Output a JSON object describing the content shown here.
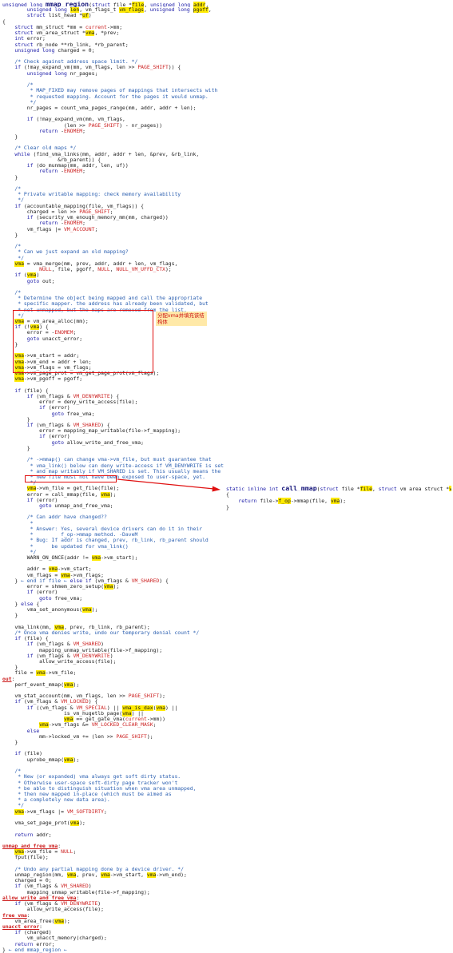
{
  "code_lines": [
    "<span class=\"k\">unsigned long</span> <span class=\"fn big\">mmap_region</span>(<span class=\"k\">struct</span> file *<span class=\"hl\">file</span>, <span class=\"k\">unsigned long</span> <span class=\"hl\">addr</span>,",
    "        <span class=\"k\">unsigned long</span> <span class=\"hl\">len</span>, vm_flags_t <span class=\"hl\">vm_flags</span>, <span class=\"k\">unsigned long</span> <span class=\"hl\">pgoff</span>,",
    "        <span class=\"k\">struct</span> list_head *<span class=\"hl\">uf</span>)",
    "{",
    "    <span class=\"k\">struct</span> mm_struct *mm = <span class=\"m\">current</span>-&gt;mm;",
    "    <span class=\"k\">struct</span> vm_area_struct *<span class=\"hl\">vma</span>, *prev;",
    "    <span class=\"k\">int</span> error;",
    "    <span class=\"k\">struct</span> rb_node **rb_link, *rb_parent;",
    "    <span class=\"k\">unsigned long</span> charged = 0;",
    "",
    "    <span class=\"c\">/* Check against address space limit. */</span>",
    "    <span class=\"k\">if</span> (!may_expand_vm(mm, vm_flags, len &gt;&gt; <span class=\"m\">PAGE_SHIFT</span>)) {",
    "        <span class=\"k\">unsigned long</span> nr_pages;",
    "",
    "<span class=\"c\">        /*</span>",
    "<span class=\"c\">         * MAP_FIXED may remove pages of mappings that intersects with</span>",
    "<span class=\"c\">         * requested mapping. Account for the pages it would unmap.</span>",
    "<span class=\"c\">         */</span>",
    "        nr_pages = count_vma_pages_range(mm, addr, addr + len);",
    "",
    "        <span class=\"k\">if</span> (!may_expand_vm(mm, vm_flags,",
    "                    (len &gt;&gt; <span class=\"m\">PAGE_SHIFT</span>) - nr_pages))",
    "            <span class=\"k\">return</span> -<span class=\"m\">ENOMEM</span>;",
    "    }",
    "",
    "    <span class=\"c\">/* Clear old maps */</span>",
    "    <span class=\"k\">while</span> (find_vma_links(mm, addr, addr + len, &amp;prev, &amp;rb_link,",
    "                  &amp;rb_parent)) {",
    "        <span class=\"k\">if</span> (do_munmap(mm, addr, len, uf))",
    "            <span class=\"k\">return</span> -<span class=\"m\">ENOMEM</span>;",
    "    }",
    "",
    "<span class=\"c\">    /*</span>",
    "<span class=\"c\">     * Private writable mapping: check memory availability</span>",
    "<span class=\"c\">     */</span>",
    "    <span class=\"k\">if</span> (accountable_mapping(file, vm_flags)) {",
    "        charged = len &gt;&gt; <span class=\"m\">PAGE_SHIFT</span>;",
    "        <span class=\"k\">if</span> (security_vm_enough_memory_mm(mm, charged))",
    "            <span class=\"k\">return</span> -<span class=\"m\">ENOMEM</span>;",
    "        vm_flags |= <span class=\"m\">VM_ACCOUNT</span>;",
    "    }",
    "",
    "<span class=\"c\">    /*</span>",
    "<span class=\"c\">     * Can we just expand an old mapping?</span>",
    "<span class=\"c\">     */</span>",
    "    <span class=\"hl\">vma</span> = vma_merge(mm, prev, addr, addr + len, vm_flags,",
    "            <span class=\"m\">NULL</span>, file, pgoff, <span class=\"m\">NULL</span>, <span class=\"m\">NULL_VM_UFFD_CTX</span>);",
    "    <span class=\"k\">if</span> (<span class=\"hl\">vma</span>)",
    "        <span class=\"k\">goto</span> out;",
    "",
    "<span class=\"c\">    /*</span>",
    "<span class=\"c\">     * Determine the object being mapped and call the appropriate</span>",
    "<span class=\"c\">     * specific mapper. the address has already been validated, but</span>",
    "<span class=\"c\">     * not unmapped, but the maps are removed from the list.</span>",
    "<span class=\"c\">     */</span>",
    "    <span class=\"hl\">vma</span> = vm_area_alloc(mm);",
    "    <span class=\"k\">if</span> (!<span class=\"hl\">vma</span>) {",
    "        error = -<span class=\"m\">ENOMEM</span>;",
    "        <span class=\"k\">goto</span> unacct_error;",
    "    }",
    "",
    "    <span class=\"hl\">vma</span>-&gt;vm_start = addr;",
    "    <span class=\"hl\">vma</span>-&gt;vm_end = addr + len;",
    "    <span class=\"hl\">vma</span>-&gt;vm_flags = vm_flags;",
    "    <span class=\"hl\">vma</span>-&gt;vm_page_prot = vm_get_page_prot(vm_flags);",
    "    <span class=\"hl\">vma</span>-&gt;vm_pgoff = pgoff;",
    "",
    "    <span class=\"k\">if</span> (file) {",
    "        <span class=\"k\">if</span> (vm_flags &amp; <span class=\"m\">VM_DENYWRITE</span>) {",
    "            error = deny_write_access(file);",
    "            <span class=\"k\">if</span> (error)",
    "                <span class=\"k\">goto</span> free_vma;",
    "        }",
    "        <span class=\"k\">if</span> (vm_flags &amp; <span class=\"m\">VM_SHARED</span>) {",
    "            error = mapping_map_writable(file-&gt;f_mapping);",
    "            <span class=\"k\">if</span> (error)",
    "                <span class=\"k\">goto</span> allow_write_and_free_vma;",
    "        }",
    "",
    "<span class=\"c\">        /* -&gt;mmap() can change vma-&gt;vm_file, but must guarantee that</span>",
    "<span class=\"c\">         * vma_link() below can deny write-access if VM_DENYWRITE is set</span>",
    "<span class=\"c\">         * and map writably if VM_SHARED is set. This usually means the</span>",
    "<span class=\"c\">         * new file must not have been exposed to user-space, yet.</span>",
    "<span class=\"c\">         */</span>",
    "        <span class=\"hl\">vma</span>-&gt;vm_file = get_file(file);",
    "        error = call_mmap(file, <span class=\"hl\">vma</span>);",
    "        <span class=\"k\">if</span> (error)",
    "            <span class=\"k\">goto</span> unmap_and_free_vma;",
    "",
    "        <span class=\"c\">/* Can addr have changed??</span>",
    "<span class=\"c\">         *</span>",
    "<span class=\"c\">         * Answer: Yes, several device drivers can do it in their</span>",
    "<span class=\"c\">         *         f_op-&gt;mmap method. -DaveM</span>",
    "<span class=\"c\">         * Bug: If addr is changed, prev, rb_link, rb_parent should</span>",
    "<span class=\"c\">         *      be updated for vma_link()</span>",
    "<span class=\"c\">         */</span>",
    "        WARN_ON_ONCE(addr != <span class=\"hl\">vma</span>-&gt;vm_start);",
    "",
    "        addr = <span class=\"hl\">vma</span>-&gt;vm_start;",
    "        vm_flags = <span class=\"hl\">vma</span>-&gt;vm_flags;",
    "    } <span class=\"c\">&#8592; end if file &#8592;</span> <span class=\"k\">else if</span> (vm_flags &amp; <span class=\"m\">VM_SHARED</span>) {",
    "        error = shmem_zero_setup(<span class=\"hl\">vma</span>);",
    "        <span class=\"k\">if</span> (error)",
    "            <span class=\"k\">goto</span> free_vma;",
    "    } <span class=\"k\">else</span> {",
    "        vma_set_anonymous(<span class=\"hl\">vma</span>);",
    "    }",
    "",
    "    vma_link(mm, <span class=\"hl\">vma</span>, prev, rb_link, rb_parent);",
    "    <span class=\"c\">/* Once vma denies write, undo our temporary denial count */</span>",
    "    <span class=\"k\">if</span> (file) {",
    "        <span class=\"k\">if</span> (vm_flags &amp; <span class=\"m\">VM_SHARED</span>)",
    "            mapping_unmap_writable(file-&gt;f_mapping);",
    "        <span class=\"k\">if</span> (vm_flags &amp; <span class=\"m\">VM_DENYWRITE</span>)",
    "            allow_write_access(file);",
    "    }",
    "    file = <span class=\"hl\">vma</span>-&gt;vm_file;",
    "<span class=\"lbl\">out</span>:",
    "    perf_event_mmap(<span class=\"hl\">vma</span>);",
    "",
    "    vm_stat_account(mm, vm_flags, len &gt;&gt; <span class=\"m\">PAGE_SHIFT</span>);",
    "    <span class=\"k\">if</span> (vm_flags &amp; <span class=\"m\">VM_LOCKED</span>) {",
    "        <span class=\"k\">if</span> ((vm_flags &amp; <span class=\"m\">VM_SPECIAL</span>) || <span class=\"hl\">vma_is_dax</span>(<span class=\"hl\">vma</span>) ||",
    "                    is_vm_hugetlb_page(<span class=\"hl\">vma</span>) ||",
    "                    <span class=\"hl\">vma</span> == get_gate_vma(<span class=\"m\">current</span>-&gt;mm))",
    "            <span class=\"hl\">vma</span>-&gt;vm_flags &amp;= <span class=\"m\">VM_LOCKED_CLEAR_MASK</span>;",
    "        <span class=\"k\">else</span>",
    "            mm-&gt;locked_vm += (len &gt;&gt; <span class=\"m\">PAGE_SHIFT</span>);",
    "    }",
    "",
    "    <span class=\"k\">if</span> (file)",
    "        uprobe_mmap(<span class=\"hl\">vma</span>);",
    "",
    "<span class=\"c\">    /*</span>",
    "<span class=\"c\">     * New (or expanded) vma always get soft dirty status.</span>",
    "<span class=\"c\">     * Otherwise user-space soft-dirty page tracker won't</span>",
    "<span class=\"c\">     * be able to distinguish situation when vma area unmapped,</span>",
    "<span class=\"c\">     * then new mapped in-place (which must be aimed as</span>",
    "<span class=\"c\">     * a completely new data area).</span>",
    "<span class=\"c\">     */</span>",
    "    <span class=\"hl\">vma</span>-&gt;vm_flags |= <span class=\"m\">VM_SOFTDIRTY</span>;",
    "",
    "    vma_set_page_prot(<span class=\"hl\">vma</span>);",
    "",
    "    <span class=\"k\">return</span> addr;",
    "",
    "<span class=\"lbl\">unmap_and_free_vma</span>:",
    "    <span class=\"hl\">vma</span>-&gt;vm_file = <span class=\"m\">NULL</span>;",
    "    fput(file);",
    "",
    "    <span class=\"c\">/* Undo any partial mapping done by a device driver. */</span>",
    "    unmap_region(mm, <span class=\"hl\">vma</span>, prev, <span class=\"hl\">vma</span>-&gt;vm_start, <span class=\"hl\">vma</span>-&gt;vm_end);",
    "    charged = 0;",
    "    <span class=\"k\">if</span> (vm_flags &amp; <span class=\"m\">VM_SHARED</span>)",
    "        mapping_unmap_writable(file-&gt;f_mapping);",
    "<span class=\"lbl\">allow_write_and_free_vma</span>:",
    "    <span class=\"k\">if</span> (vm_flags &amp; <span class=\"m\">VM_DENYWRITE</span>)",
    "        allow_write_access(file);",
    "<span class=\"lbl\">free_vma</span>:",
    "    vm_area_free(<span class=\"hl\">vma</span>);",
    "<span class=\"lbl\">unacct_error</span>:",
    "    <span class=\"k\">if</span> (charged)",
    "        vm_unacct_memory(charged);",
    "    <span class=\"k\">return</span> error;",
    "} <span class=\"c\">&#8592; end mmap_region &#8592;</span>"
  ],
  "annotation_note": "分配vma并填充该结构体",
  "inline_lines": [
    "<span class=\"k\">static inline int</span> <span class=\"fn big\">call_mmap</span>(<span class=\"k\">struct</span> file *<span class=\"hl\">file</span>, <span class=\"k\">struct</span> vm_area_struct *<span class=\"hl\">vma</span>)",
    "{",
    "    <span class=\"k\">return</span> file-&gt;<span class=\"hl\">f_op</span>-&gt;mmap(file, <span class=\"hl\">vma</span>);",
    "}"
  ],
  "colors": {
    "highlight": "#ffea00",
    "annotation_border": "#e01010",
    "keyword": "#1c1ca8",
    "comment": "#2b5fb0",
    "macro": "#cc2020"
  }
}
